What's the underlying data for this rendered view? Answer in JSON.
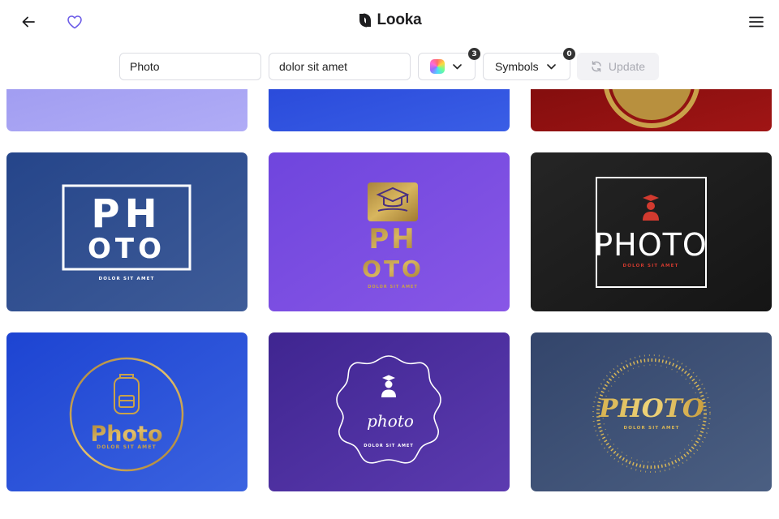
{
  "header": {
    "brand_name": "Looka",
    "back_icon": "arrow-left-icon",
    "favorite_icon": "heart-icon",
    "menu_icon": "hamburger-menu-icon"
  },
  "filters": {
    "company_name": "Photo",
    "slogan": "dolor sit amet",
    "colors_count": "3",
    "symbols_label": "Symbols",
    "symbols_count": "0",
    "update_label": "Update"
  },
  "logos": [
    {
      "text": "PH",
      "text2": "OTO",
      "tagline": "DOLOR SIT AMET",
      "bg": "#2d4e8e"
    },
    {
      "text": "PH",
      "text2": "OTO",
      "tagline": "DOLOR SIT AMET",
      "bg": "#7a4de0"
    },
    {
      "text": "PHOTO",
      "tagline": "DOLOR SIT AMET",
      "bg": "#1f1f1f"
    },
    {
      "text": "Photo",
      "tagline": "DOLOR SIT AMET",
      "bg": "#1f4bd6"
    },
    {
      "text": "photo",
      "tagline": "DOLOR SIT AMET",
      "bg": "#4a2ea0"
    },
    {
      "text": "PHOTO",
      "tagline": "DOLOR SIT AMET",
      "bg": "#3c4d70"
    }
  ],
  "colors": {
    "accent": "#6c5ce7",
    "gold": "#c9a24a",
    "red": "#d23a2f"
  }
}
